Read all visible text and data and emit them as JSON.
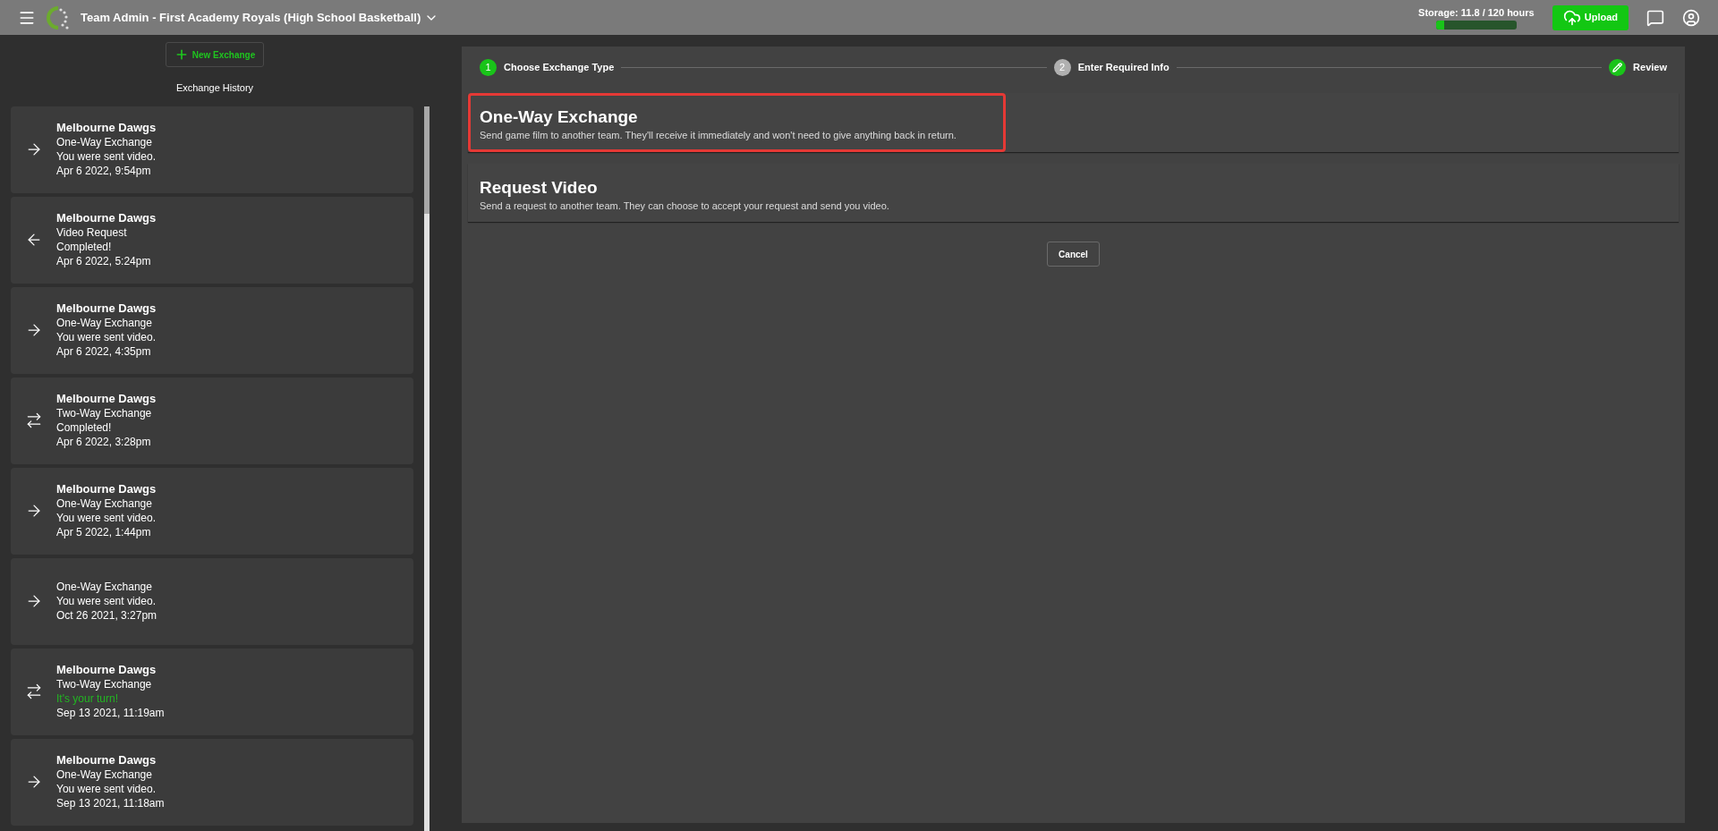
{
  "header": {
    "title": "Team Admin - First Academy Royals (High School Basketball)",
    "storage": {
      "label": "Storage: 11.8 / 120 hours",
      "level": 0.098
    },
    "upload_button": "Upload"
  },
  "sidebar": {
    "new_button": "New Exchange",
    "heading": "Exchange History",
    "items": [
      {
        "kind": "send",
        "team": "Melbourne Dawgs",
        "type": "One-Way Exchange",
        "status": {
          "text": "You were sent video.",
          "attention": false
        },
        "date": "Apr 6 2022, 9:54pm"
      },
      {
        "kind": "request",
        "team": "Melbourne Dawgs",
        "type": "Video Request",
        "status": {
          "text": "Completed!",
          "attention": false
        },
        "date": "Apr 6 2022, 5:24pm"
      },
      {
        "kind": "send",
        "team": "Melbourne Dawgs",
        "type": "One-Way Exchange",
        "status": {
          "text": "You were sent video.",
          "attention": false
        },
        "date": "Apr 6 2022, 4:35pm"
      },
      {
        "kind": "swap",
        "team": "Melbourne Dawgs",
        "type": "Two-Way Exchange",
        "status": {
          "text": "Completed!",
          "attention": false
        },
        "date": "Apr 6 2022, 3:28pm"
      },
      {
        "kind": "send",
        "team": "Melbourne Dawgs",
        "type": "One-Way Exchange",
        "status": {
          "text": "You were sent video.",
          "attention": false
        },
        "date": "Apr 5 2022, 1:44pm"
      },
      {
        "kind": "send",
        "type": "One-Way Exchange",
        "status": {
          "text": "You were sent video.",
          "attention": false
        },
        "date": "Oct 26 2021, 3:27pm"
      },
      {
        "kind": "swap",
        "team": "Melbourne Dawgs",
        "type": "Two-Way Exchange",
        "status": {
          "text": "It's your turn!",
          "attention": true
        },
        "date": "Sep 13 2021, 11:19am"
      },
      {
        "kind": "send",
        "team": "Melbourne Dawgs",
        "type": "One-Way Exchange",
        "status": {
          "text": "You were sent video.",
          "attention": false
        },
        "date": "Sep 13 2021, 11:18am"
      }
    ]
  },
  "stepper": [
    {
      "kind": "number",
      "marker": "1",
      "label": "Choose Exchange Type",
      "highlighted": true
    },
    {
      "kind": "number",
      "marker": "2",
      "label": "Enter Required Info",
      "highlighted": false
    },
    {
      "kind": "edit",
      "label": "Review",
      "highlighted": true
    }
  ],
  "options": [
    {
      "title": "One-Way Exchange",
      "description": "Send game film to another team. They'll receive it immediately and won't need to give anything back in return.",
      "selected": true
    },
    {
      "title": "Request Video",
      "description": "Send a request to another team. They can choose to accept your request and send you video.",
      "selected": false
    }
  ],
  "cancel_button": "Cancel"
}
